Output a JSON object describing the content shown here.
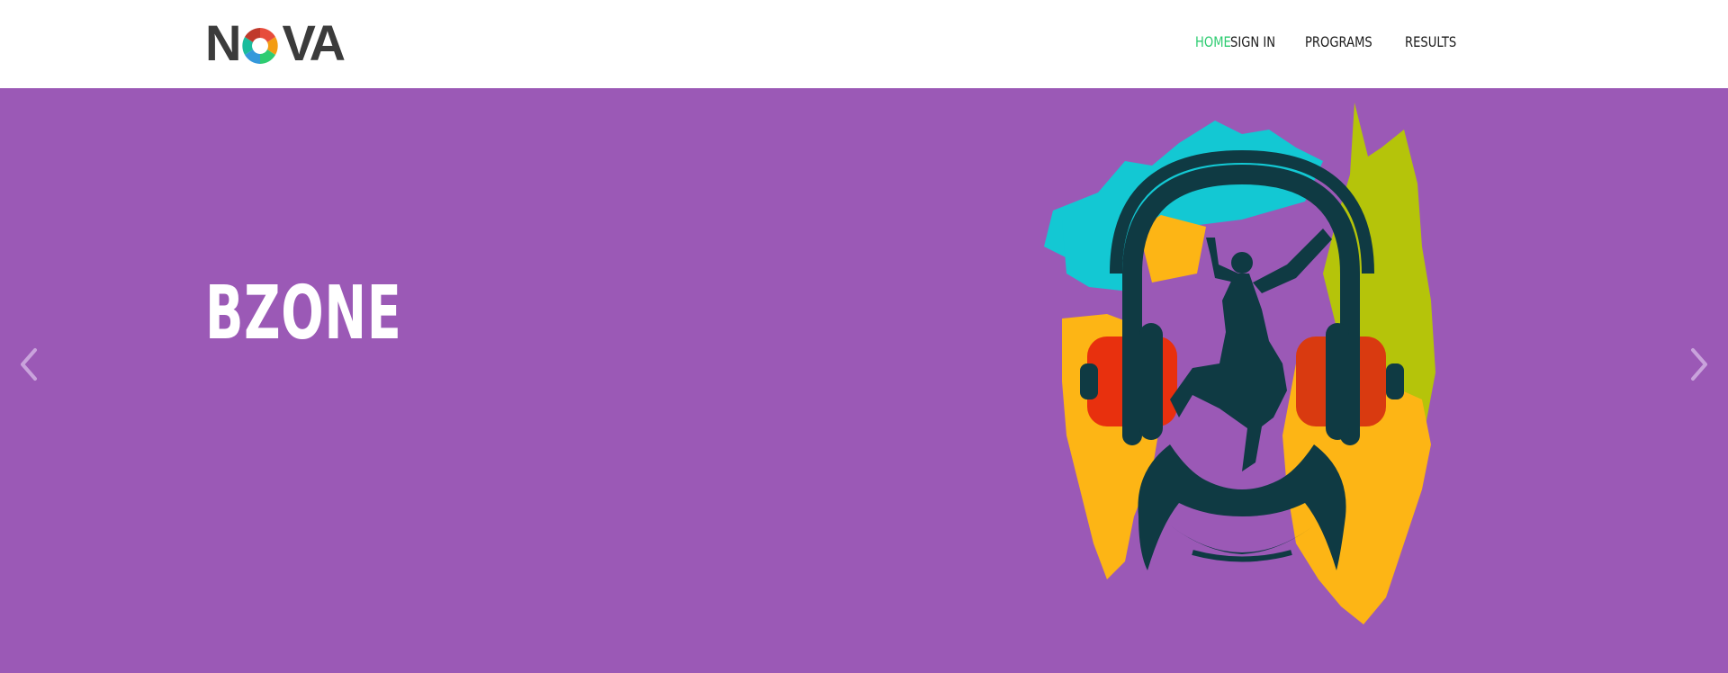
{
  "brand": {
    "logo_text_left": "N",
    "logo_text_right": "VA",
    "colors": {
      "text": "#3b3b3b",
      "red": "#e74c3c",
      "blue": "#3498db",
      "green": "#2ecc71",
      "orange": "#f39c12"
    }
  },
  "nav": {
    "items": [
      {
        "label": "HOME",
        "active": true
      },
      {
        "label": "SIGN IN",
        "active": false
      },
      {
        "label": "PROGRAMS",
        "active": false
      },
      {
        "label": "RESULTS",
        "active": false
      }
    ],
    "active_color": "#2ecc71",
    "text_color": "#1a1a1a"
  },
  "hero": {
    "title": "BZONE",
    "background_color": "#9b59b6",
    "prev_icon": "chevron-left-icon",
    "next_icon": "chevron-right-icon",
    "artwork": "headphones-dancer-illustration",
    "art_colors": {
      "cyan": "#13c8d3",
      "yellow": "#fdb515",
      "lime": "#b5c40a",
      "red": "#e8300e",
      "dark": "#0f3a43"
    }
  }
}
